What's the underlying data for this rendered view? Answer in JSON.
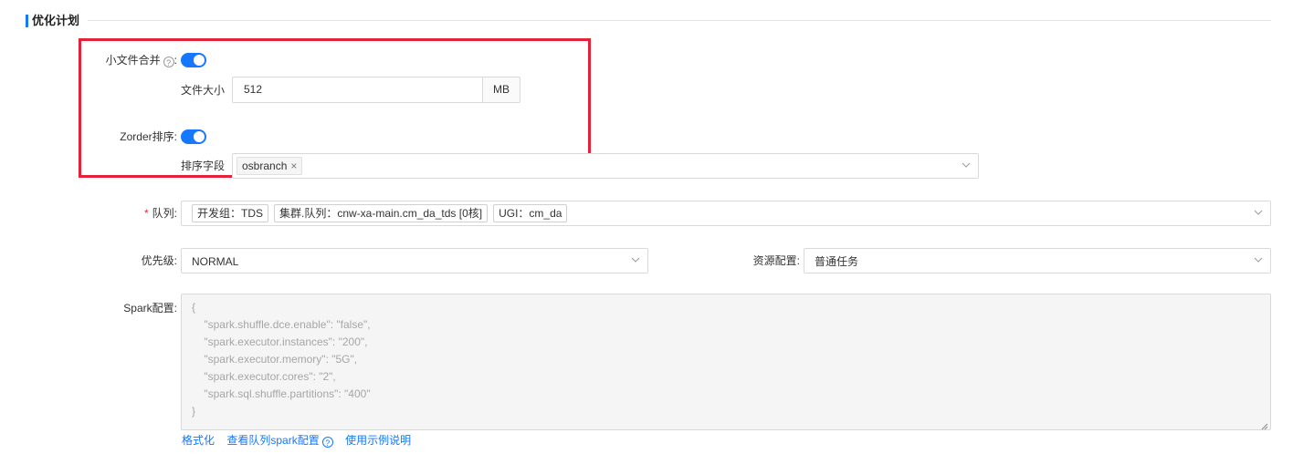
{
  "section": {
    "title": "优化计划"
  },
  "small_file_merge": {
    "label": "小文件合并",
    "help": "?",
    "colon": ":",
    "enabled": true,
    "file_size_label": "文件大小",
    "file_size_value": "512",
    "file_size_unit": "MB"
  },
  "zorder": {
    "label": "Zorder排序",
    "colon": ":",
    "enabled": true,
    "sort_field_label": "排序字段",
    "sort_fields": [
      "osbranch"
    ],
    "remove_symbol": "×"
  },
  "queue": {
    "required_mark": "*",
    "label": "队列",
    "colon": ":",
    "tags": [
      "开发组：TDS",
      "集群.队列：cnw-xa-main.cm_da_tds [0核]",
      "UGI：cm_da"
    ]
  },
  "priority": {
    "label": "优先级",
    "colon": ":",
    "value": "NORMAL"
  },
  "resource": {
    "label": "资源配置",
    "colon": ":",
    "value": "普通任务"
  },
  "spark": {
    "label": "Spark配置",
    "colon": ":",
    "placeholder_lines": [
      "{",
      "    \"spark.shuffle.dce.enable\": \"false\",",
      "    \"spark.executor.instances\": \"200\",",
      "    \"spark.executor.memory\": \"5G\",",
      "    \"spark.executor.cores\": \"2\",",
      "    \"spark.sql.shuffle.partitions\": \"400\"",
      "}"
    ]
  },
  "links": {
    "format": "格式化",
    "view_queue_spark": "查看队列spark配置",
    "usage_example": "使用示例说明",
    "help": "?"
  },
  "colors": {
    "accent": "#1677ff",
    "highlight": "#e8213a",
    "required": "#f5222d"
  }
}
